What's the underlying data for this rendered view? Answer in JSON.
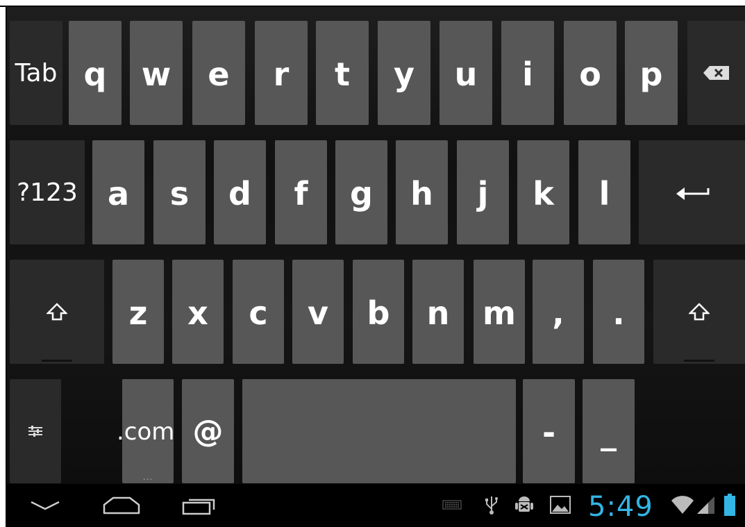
{
  "keyboard": {
    "row1": {
      "tab_label": "Tab",
      "letters": [
        "q",
        "w",
        "e",
        "r",
        "t",
        "y",
        "u",
        "i",
        "o",
        "p"
      ],
      "backspace_icon": "backspace-icon"
    },
    "row2": {
      "symbols_label": "?123",
      "letters": [
        "a",
        "s",
        "d",
        "f",
        "g",
        "h",
        "j",
        "k",
        "l"
      ],
      "enter_icon": "enter-arrow-icon"
    },
    "row3": {
      "shift_icon": "shift-arrow-icon",
      "letters": [
        "z",
        "x",
        "c",
        "v",
        "b",
        "n",
        "m",
        ",",
        "."
      ]
    },
    "row4": {
      "settings_icon": "settings-sliders-icon",
      "dotcom_label": ".com",
      "dotcom_more": "...",
      "at_label": "@",
      "dash_label": "-",
      "underscore_label": "_"
    }
  },
  "status_bar": {
    "time": "5:49",
    "icons": [
      "keyboard-icon",
      "usb-icon",
      "android-debug-icon",
      "gallery-icon",
      "wifi-icon",
      "signal-icon",
      "battery-icon"
    ],
    "accent_color": "#33b5e5"
  },
  "navigation": {
    "buttons": [
      "hide-keyboard-icon",
      "home-icon",
      "recents-icon"
    ]
  }
}
